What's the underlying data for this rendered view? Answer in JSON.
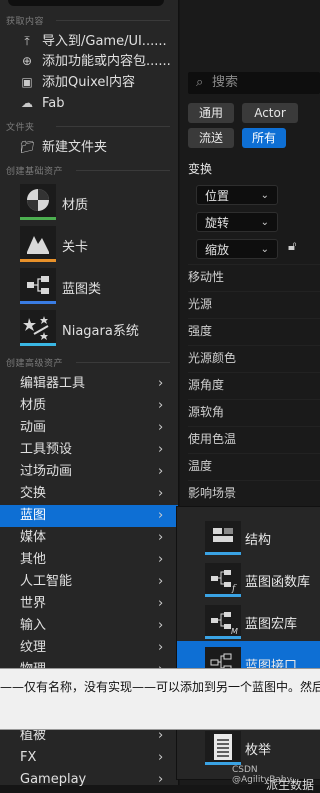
{
  "details": {
    "search_placeholder": "搜索",
    "filters": [
      "通用",
      "Actor",
      "流送",
      "所有"
    ],
    "transform_header": "变换",
    "transform_rows": [
      {
        "label": "位置"
      },
      {
        "label": "旋转"
      },
      {
        "label": "缩放"
      }
    ],
    "rows": [
      "移动性",
      "光源",
      "强度",
      "光源颜色",
      "源角度",
      "源软角",
      "使用色温",
      "温度",
      "影响场景"
    ]
  },
  "menu": {
    "sections": {
      "get_content": "获取内容",
      "folder": "文件夹",
      "basic_assets": "创建基础资产",
      "advanced_assets": "创建高级资产"
    },
    "get_content_items": [
      {
        "icon": "import-icon",
        "label": "导入到/Game/UI......"
      },
      {
        "icon": "add-feature-icon",
        "label": "添加功能或内容包......"
      },
      {
        "icon": "quixel-icon",
        "label": "添加Quixel内容"
      },
      {
        "icon": "fab-icon",
        "label": "Fab"
      }
    ],
    "folder_items": [
      {
        "icon": "new-folder-icon",
        "label": "新建文件夹"
      }
    ],
    "basic_assets": [
      {
        "label": "材质",
        "color": "#4caf50"
      },
      {
        "label": "关卡",
        "color": "#e8912a"
      },
      {
        "label": "蓝图类",
        "color": "#3a7de4"
      },
      {
        "label": "Niagara系统",
        "color": "#3ab7e4"
      }
    ],
    "advanced_categories": [
      "编辑器工具",
      "材质",
      "动画",
      "工具预设",
      "过场动画",
      "交换",
      "蓝图",
      "媒体",
      "其他",
      "人工智能",
      "世界",
      "输入",
      "纹理",
      "物理",
      "植被",
      "FX",
      "Gameplay"
    ],
    "selected_category": "蓝图"
  },
  "submenu": {
    "items": [
      "结构",
      "蓝图函数库",
      "蓝图宏库",
      "蓝图接口",
      "枚举"
    ],
    "selected": "蓝图接口"
  },
  "tooltip": {
    "text": "——仅有名称，没有实现——可以添加到另一个蓝图中。然后其"
  },
  "watermark": "CSDN @AgilityBaby",
  "bottom_label": "派生数据"
}
